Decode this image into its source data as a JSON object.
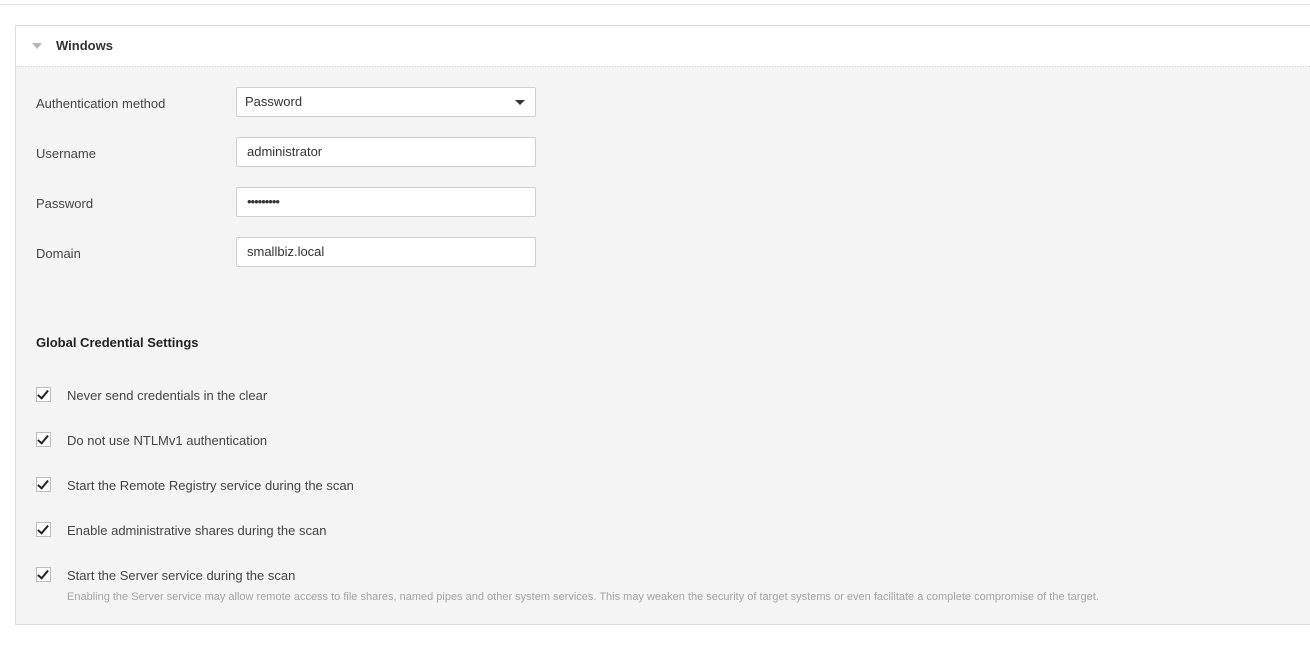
{
  "section": {
    "title": "Windows"
  },
  "form": {
    "auth_method": {
      "label": "Authentication method",
      "value": "Password"
    },
    "username": {
      "label": "Username",
      "value": "administrator"
    },
    "password": {
      "label": "Password",
      "value": "•••••••••"
    },
    "domain": {
      "label": "Domain",
      "value": "smallbiz.local"
    }
  },
  "global_settings": {
    "title": "Global Credential Settings",
    "options": [
      {
        "label": "Never send credentials in the clear",
        "checked": true
      },
      {
        "label": "Do not use NTLMv1 authentication",
        "checked": true
      },
      {
        "label": "Start the Remote Registry service during the scan",
        "checked": true
      },
      {
        "label": "Enable administrative shares during the scan",
        "checked": true
      },
      {
        "label": "Start the Server service during the scan",
        "checked": true
      }
    ],
    "server_service_help": "Enabling the Server service may allow remote access to file shares, named pipes and other system services. This may weaken the security of target systems or even facilitate a complete compromise of the target."
  }
}
